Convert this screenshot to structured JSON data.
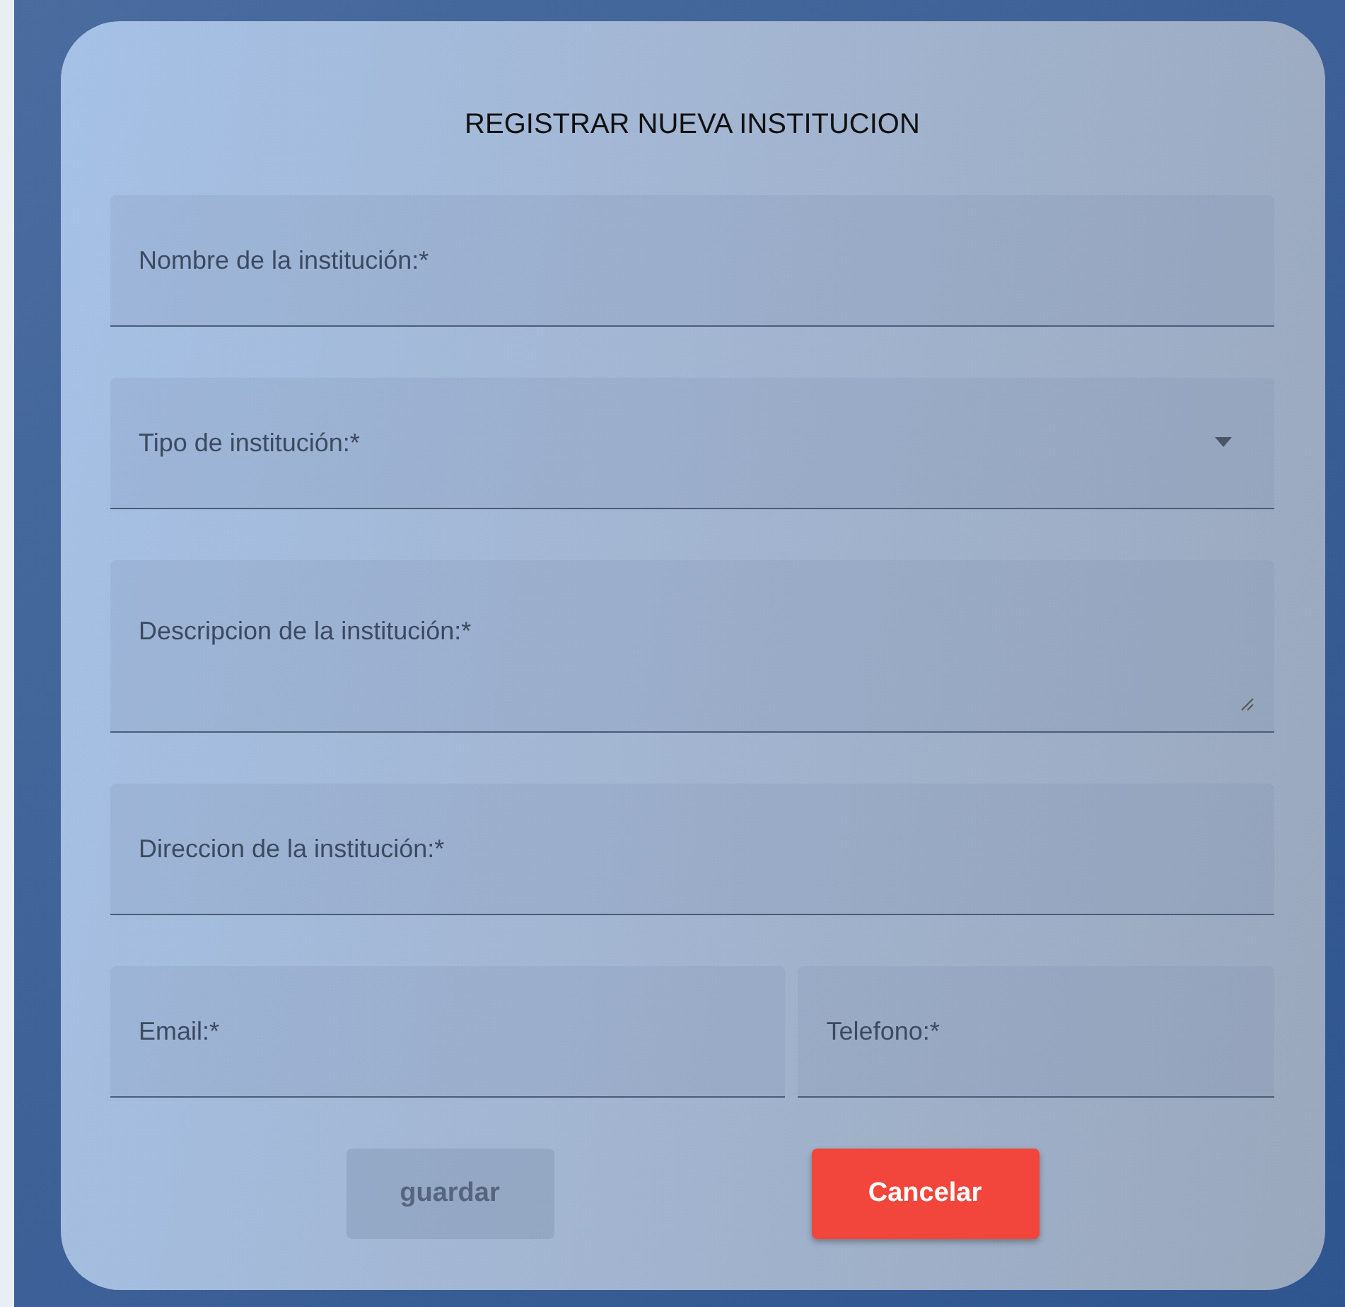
{
  "title": "REGISTRAR NUEVA INSTITUCION",
  "rows": [
    {
      "fields": [
        {
          "kind": "text",
          "label": "Nombre de la institución:*"
        }
      ]
    },
    {
      "fields": [
        {
          "kind": "select",
          "label": "Tipo de institución:*"
        }
      ]
    },
    {
      "fields": [
        {
          "kind": "textarea",
          "label": "Descripcion de la institución:*"
        }
      ]
    },
    {
      "fields": [
        {
          "kind": "text",
          "label": "Direccion de la institución:*"
        }
      ]
    },
    {
      "fields": [
        {
          "kind": "text",
          "label": "Email:*"
        },
        {
          "kind": "text",
          "label": "Telefono:*"
        }
      ]
    }
  ],
  "buttons": [
    {
      "kind": "primary",
      "label": "guardar",
      "disabled": true
    },
    {
      "kind": "danger",
      "label": "Cancelar",
      "disabled": false
    }
  ]
}
